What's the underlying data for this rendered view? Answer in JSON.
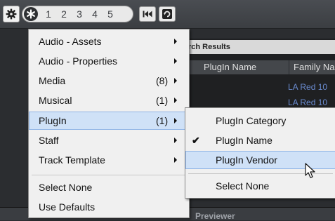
{
  "toolbar": {
    "settings_icon": "gear-icon",
    "rating_star_icon": "asterisk-icon",
    "rating_values": [
      "1",
      "2",
      "3",
      "4",
      "5"
    ],
    "rewind_icon": "skip-to-start-icon",
    "refresh_icon": "refresh-icon"
  },
  "background": {
    "search_results_title": "rch Results",
    "columns": [
      "PlugIn Name",
      "Family Na"
    ],
    "rows": [
      "LA Red 10",
      "LA Red 10"
    ],
    "previewer_label": "Previewer"
  },
  "main_menu": {
    "items": [
      {
        "label": "Audio - Assets",
        "count": "",
        "submenu": true
      },
      {
        "label": "Audio - Properties",
        "count": "",
        "submenu": true
      },
      {
        "label": "Media",
        "count": "(8)",
        "submenu": true
      },
      {
        "label": "Musical",
        "count": "(1)",
        "submenu": true
      },
      {
        "label": "PlugIn",
        "count": "(1)",
        "submenu": true,
        "highlighted": true
      },
      {
        "label": "Staff",
        "count": "",
        "submenu": true
      },
      {
        "label": "Track Template",
        "count": "",
        "submenu": true
      },
      {
        "label": "Select None",
        "count": "",
        "submenu": false
      },
      {
        "label": "Use Defaults",
        "count": "",
        "submenu": false
      }
    ]
  },
  "sub_menu": {
    "items": [
      {
        "label": "PlugIn Category",
        "checked": false
      },
      {
        "label": "PlugIn Name",
        "checked": true
      },
      {
        "label": "PlugIn Vendor",
        "checked": false,
        "highlighted": true
      },
      {
        "label": "Select None",
        "checked": false
      }
    ],
    "check_icon": "checkmark-icon"
  },
  "colors": {
    "highlight": "#cfe1f7",
    "menu_bg": "#f0f0f0",
    "link_text": "#6a8bd0"
  }
}
